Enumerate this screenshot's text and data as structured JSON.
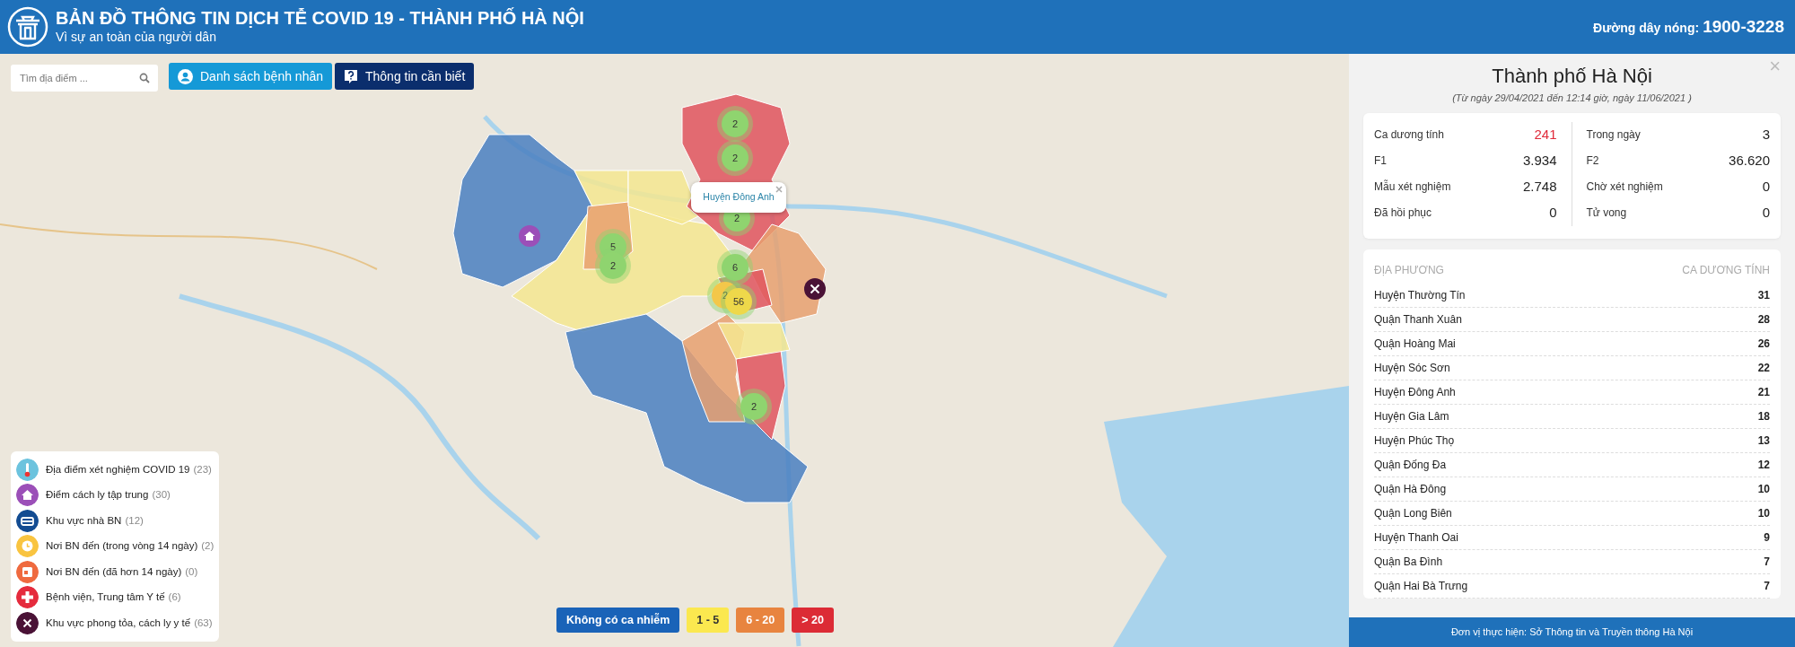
{
  "header": {
    "title": "BẢN ĐỒ THÔNG TIN DỊCH TỄ COVID 19 - THÀNH PHỐ HÀ NỘI",
    "subtitle": "Vì sự an toàn của người dân",
    "hotline_label": "Đường dây nóng:",
    "hotline_number": "1900-3228"
  },
  "search": {
    "placeholder": "Tìm địa điểm ..."
  },
  "buttons": [
    {
      "label": "Danh sách bệnh nhân",
      "kind": "patients"
    },
    {
      "label": "Thông tin cần biết",
      "kind": "info"
    }
  ],
  "map": {
    "clusters": [
      {
        "count": "2",
        "color": "#8fd46f"
      },
      {
        "count": "2",
        "color": "#8fd46f"
      },
      {
        "count": "2",
        "color": "#8fd46f"
      },
      {
        "count": "5",
        "color": "#8fd46f"
      },
      {
        "count": "2",
        "color": "#8fd46f"
      },
      {
        "count": "6",
        "color": "#8fd46f"
      },
      {
        "count": "2",
        "color": "#f3c74a"
      },
      {
        "count": "56",
        "color": "#eed84a"
      },
      {
        "count": "2",
        "color": "#8fd46f"
      }
    ],
    "markers": [
      {
        "kind": "quarantine"
      },
      {
        "kind": "lockdown"
      }
    ],
    "popup": {
      "title": "Huyện Đông Anh"
    }
  },
  "legend": [
    {
      "kind": "test",
      "label": "Địa điểm xét nghiệm COVID 19",
      "count": "(23)"
    },
    {
      "kind": "quarantine",
      "label": "Điểm cách ly tập trung",
      "count": "(30)"
    },
    {
      "kind": "home",
      "label": "Khu vực nhà BN",
      "count": "(12)"
    },
    {
      "kind": "recent",
      "label": "Nơi BN đến (trong vòng 14 ngày)",
      "count": "(2)"
    },
    {
      "kind": "old",
      "label": "Nơi BN đến (đã hơn 14 ngày)",
      "count": "(0)"
    },
    {
      "kind": "hospital",
      "label": "Bệnh viện, Trung tâm Y tế",
      "count": "(6)"
    },
    {
      "kind": "lockdown",
      "label": "Khu vực phong tỏa, cách ly y tế",
      "count": "(63)"
    }
  ],
  "scale": [
    {
      "label": "Không có ca nhiễm",
      "color": "#1a63b8"
    },
    {
      "label": "1 - 5",
      "color": "#fbe84f"
    },
    {
      "label": "6 - 20",
      "color": "#e8843f"
    },
    {
      "label": "> 20",
      "color": "#dc2b35"
    }
  ],
  "panel": {
    "close": "×",
    "title": "Thành phố Hà Nội",
    "period": "(Từ ngày 29/04/2021 đến 12:14 giờ, ngày 11/06/2021 )",
    "stats": [
      {
        "label": "Ca dương tính",
        "value": "241",
        "alert": true
      },
      {
        "label": "Trong ngày",
        "value": "3",
        "alert": false
      },
      {
        "label": "F1",
        "value": "3.934",
        "alert": false
      },
      {
        "label": "F2",
        "value": "36.620",
        "alert": false
      },
      {
        "label": "Mẫu xét nghiệm",
        "value": "2.748",
        "alert": false
      },
      {
        "label": "Chờ xét nghiệm",
        "value": "0",
        "alert": false
      },
      {
        "label": "Đã hồi phục",
        "value": "0",
        "alert": false
      },
      {
        "label": "Tử vong",
        "value": "0",
        "alert": false
      }
    ],
    "table": {
      "columns": [
        "ĐỊA PHƯƠNG",
        "CA DƯƠNG TÍNH"
      ],
      "rows": [
        {
          "name": "Huyện Thường Tín",
          "count": "31"
        },
        {
          "name": "Quận Thanh Xuân",
          "count": "28"
        },
        {
          "name": "Quận Hoàng Mai",
          "count": "26"
        },
        {
          "name": "Huyện Sóc Sơn",
          "count": "22"
        },
        {
          "name": "Huyện Đông Anh",
          "count": "21"
        },
        {
          "name": "Huyện Gia Lâm",
          "count": "18"
        },
        {
          "name": "Huyện Phúc Thọ",
          "count": "13"
        },
        {
          "name": "Quận Đống Đa",
          "count": "12"
        },
        {
          "name": "Quận Hà Đông",
          "count": "10"
        },
        {
          "name": "Quận Long Biên",
          "count": "10"
        },
        {
          "name": "Huyện Thanh Oai",
          "count": "9"
        },
        {
          "name": "Quận Ba Đình",
          "count": "7"
        },
        {
          "name": "Quận Hai Bà Trưng",
          "count": "7"
        }
      ]
    }
  },
  "footer": "Đơn vị thực hiện: Sở Thông tin và Truyền thông Hà Nội"
}
